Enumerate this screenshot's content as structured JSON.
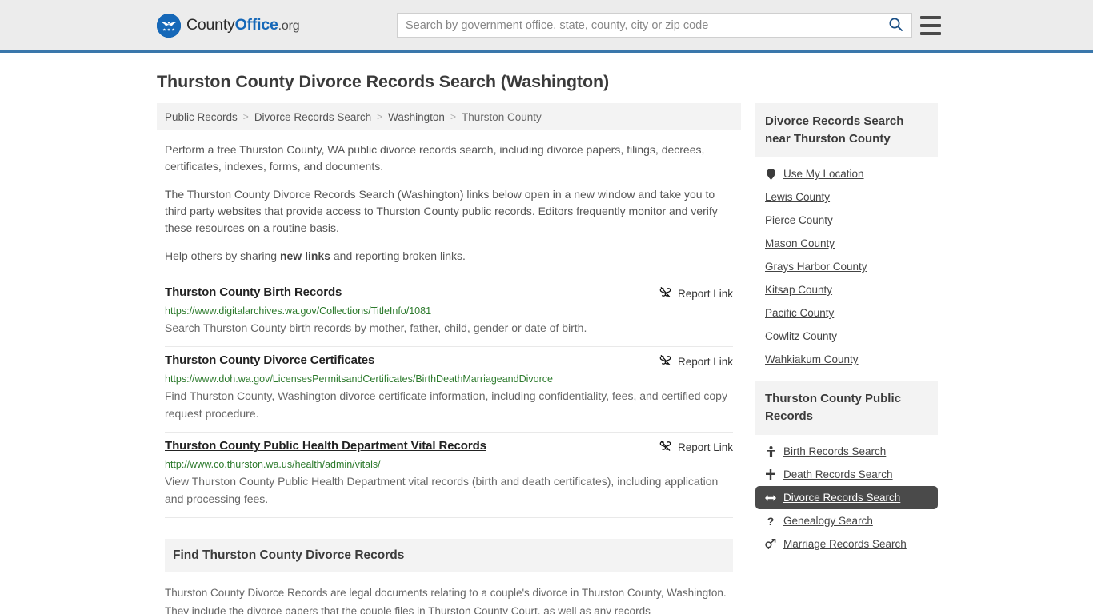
{
  "header": {
    "logo": {
      "pre": "County",
      "bold": "Office",
      "tld": ".org",
      "icon": "eagle-seal-icon"
    },
    "search": {
      "placeholder": "Search by government office, state, county, city or zip code",
      "value": ""
    },
    "search_icon": "search-icon",
    "menu_icon": "hamburger-menu-icon"
  },
  "page": {
    "title": "Thurston County Divorce Records Search (Washington)"
  },
  "breadcrumb": {
    "items": [
      {
        "label": "Public Records",
        "current": false
      },
      {
        "label": "Divorce Records Search",
        "current": false
      },
      {
        "label": "Washington",
        "current": false
      },
      {
        "label": "Thurston County",
        "current": true
      }
    ],
    "separator": ">"
  },
  "intro": {
    "p1": "Perform a free Thurston County, WA public divorce records search, including divorce papers, filings, decrees, certificates, indexes, forms, and documents.",
    "p2": "The Thurston County Divorce Records Search (Washington) links below open in a new window and take you to third party websites that provide access to Thurston County public records. Editors frequently monitor and verify these resources on a routine basis.",
    "p3_before": "Help others by sharing ",
    "p3_link": "new links",
    "p3_after": " and reporting broken links."
  },
  "report_link_label": "Report Link",
  "report_link_icon": "broken-link-icon",
  "results": [
    {
      "title": "Thurston County Birth Records",
      "url": "https://www.digitalarchives.wa.gov/Collections/TitleInfo/1081",
      "description": "Search Thurston County birth records by mother, father, child, gender or date of birth."
    },
    {
      "title": "Thurston County Divorce Certificates",
      "url": "https://www.doh.wa.gov/LicensesPermitsandCertificates/BirthDeathMarriageandDivorce",
      "description": "Find Thurston County, Washington divorce certificate information, including confidentiality, fees, and certified copy request procedure."
    },
    {
      "title": "Thurston County Public Health Department Vital Records",
      "url": "http://www.co.thurston.wa.us/health/admin/vitals/",
      "description": "View Thurston County Public Health Department vital records (birth and death certificates), including application and processing fees."
    }
  ],
  "find_section": {
    "heading": "Find Thurston County Divorce Records",
    "body": "Thurston County Divorce Records are legal documents relating to a couple's divorce in Thurston County, Washington. They include the divorce papers that the couple files in Thurston County Court, as well as any records"
  },
  "sidebar": {
    "nearby": {
      "heading": "Divorce Records Search near Thurston County",
      "items": [
        {
          "label": "Use My Location",
          "icon": "map-pin-icon",
          "active": false
        },
        {
          "label": "Lewis County",
          "icon": "",
          "active": false
        },
        {
          "label": "Pierce County",
          "icon": "",
          "active": false
        },
        {
          "label": "Mason County",
          "icon": "",
          "active": false
        },
        {
          "label": "Grays Harbor County",
          "icon": "",
          "active": false
        },
        {
          "label": "Kitsap County",
          "icon": "",
          "active": false
        },
        {
          "label": "Pacific County",
          "icon": "",
          "active": false
        },
        {
          "label": "Cowlitz County",
          "icon": "",
          "active": false
        },
        {
          "label": "Wahkiakum County",
          "icon": "",
          "active": false
        }
      ]
    },
    "public_records": {
      "heading": "Thurston County Public Records",
      "items": [
        {
          "label": "Birth Records Search",
          "icon": "baby-icon",
          "active": false
        },
        {
          "label": "Death Records Search",
          "icon": "cross-icon",
          "active": false
        },
        {
          "label": "Divorce Records Search",
          "icon": "split-arrows-icon",
          "active": true
        },
        {
          "label": "Genealogy Search",
          "icon": "question-mark-icon",
          "active": false
        },
        {
          "label": "Marriage Records Search",
          "icon": "male-female-icon",
          "active": false
        }
      ]
    }
  },
  "colors": {
    "brand_blue": "#1668b8",
    "header_bg": "#ececec",
    "header_border": "#3a77ab",
    "url_green": "#2c7a2c",
    "active_bg": "#4a4a4a",
    "panel_bg": "#f3f3f3"
  }
}
